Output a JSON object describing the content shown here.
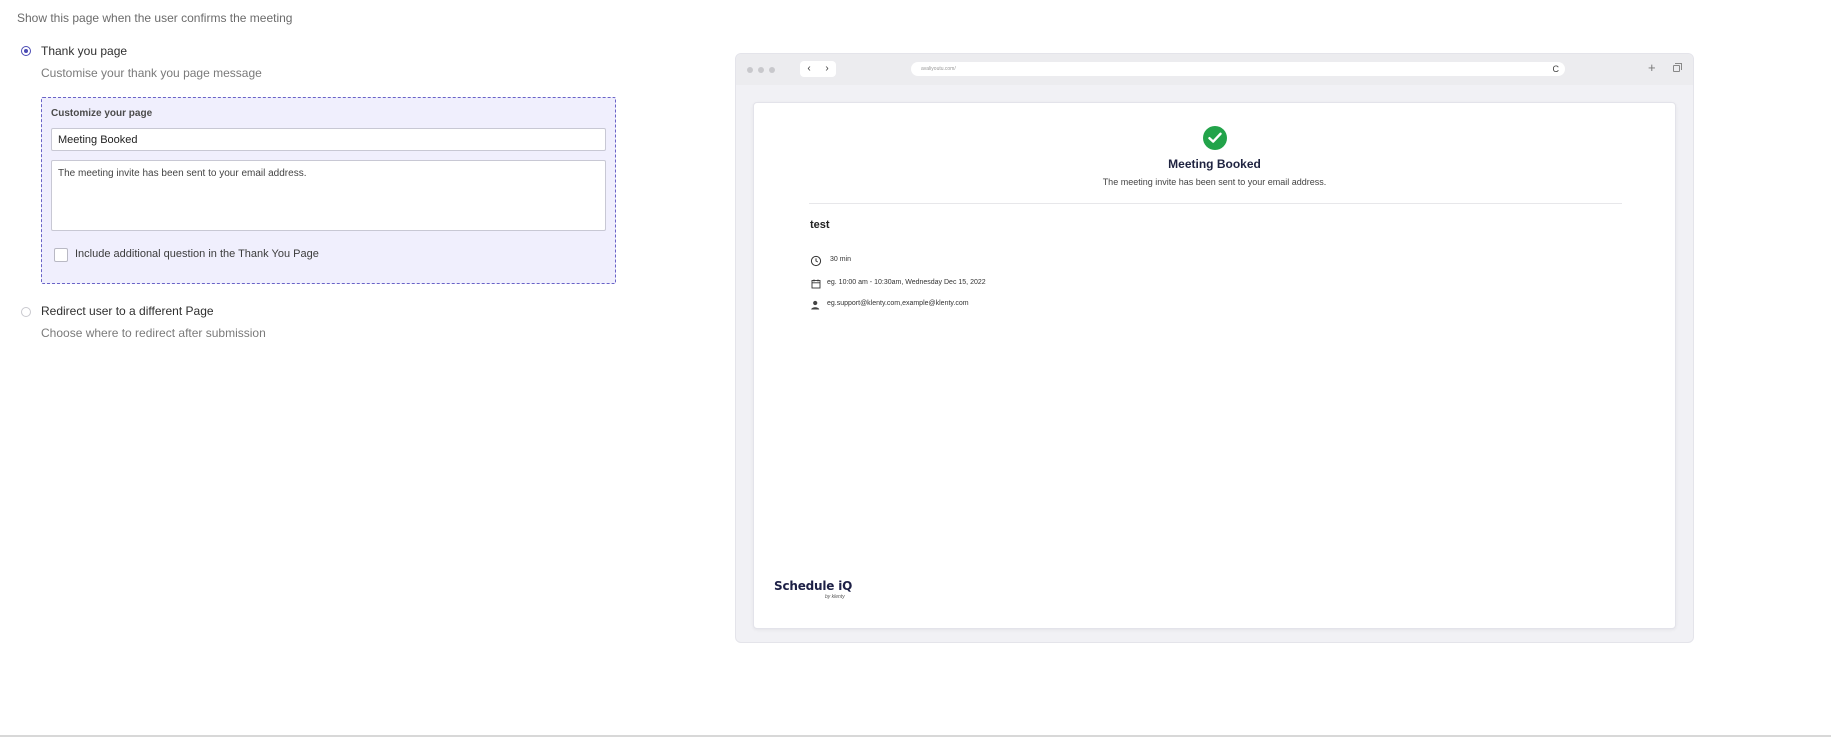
{
  "section": {
    "heading": "Show this page when the user confirms the meeting"
  },
  "options": [
    {
      "label": "Thank you page",
      "description": "Customise your thank you page message",
      "selected": true
    },
    {
      "label": "Redirect user to a different Page",
      "description": "Choose where to redirect after submission",
      "selected": false
    }
  ],
  "customize": {
    "title": "Customize your page",
    "page_title_value": "Meeting Booked",
    "message_value": "The meeting invite has been sent to your email address.",
    "additional_question_label": "Include additional question in the Thank You Page",
    "additional_question_checked": false
  },
  "preview": {
    "url": "avaliyoutu.com/",
    "reload_glyph": "C",
    "title": "Meeting Booked",
    "message": "The meeting invite has been sent to your email address.",
    "event_name": "test",
    "duration": "30 min",
    "time": "eg. 10:00 am - 10:30am, Wednesday Dec 15, 2022",
    "attendees": "eg.support@klenty.com,example@klenty.com",
    "brand": "Schedule iQ",
    "brand_sub": "by klenty",
    "success_color": "#22a34a",
    "accent_color": "#4b4bb4"
  }
}
